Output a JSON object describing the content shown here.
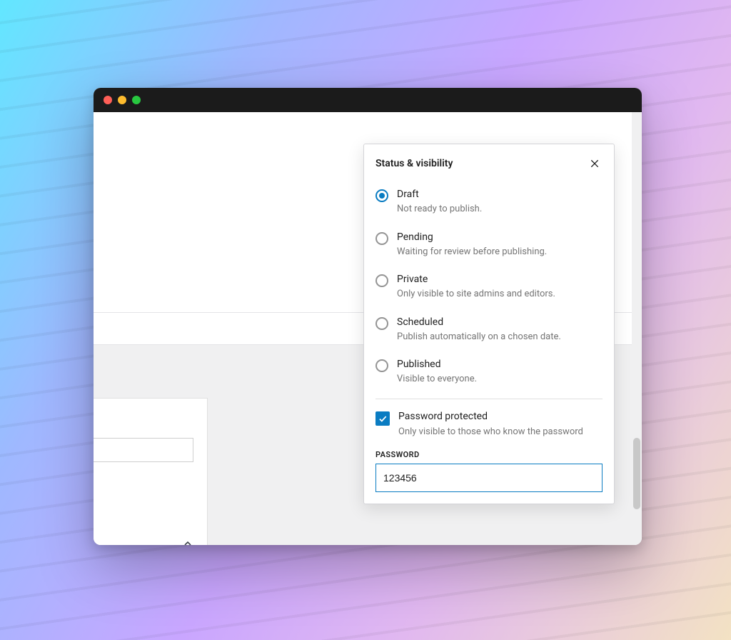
{
  "popover": {
    "title": "Status & visibility",
    "options": [
      {
        "label": "Draft",
        "desc": "Not ready to publish."
      },
      {
        "label": "Pending",
        "desc": "Waiting for review before publishing."
      },
      {
        "label": "Private",
        "desc": "Only visible to site admins and editors."
      },
      {
        "label": "Scheduled",
        "desc": "Publish automatically on a chosen date."
      },
      {
        "label": "Published",
        "desc": "Visible to everyone."
      }
    ],
    "selected_index": 0,
    "password_protected": {
      "checked": true,
      "label": "Password protected",
      "desc": "Only visible to those who know the password"
    },
    "password_field_label": "PASSWORD",
    "password_value": "123456"
  }
}
